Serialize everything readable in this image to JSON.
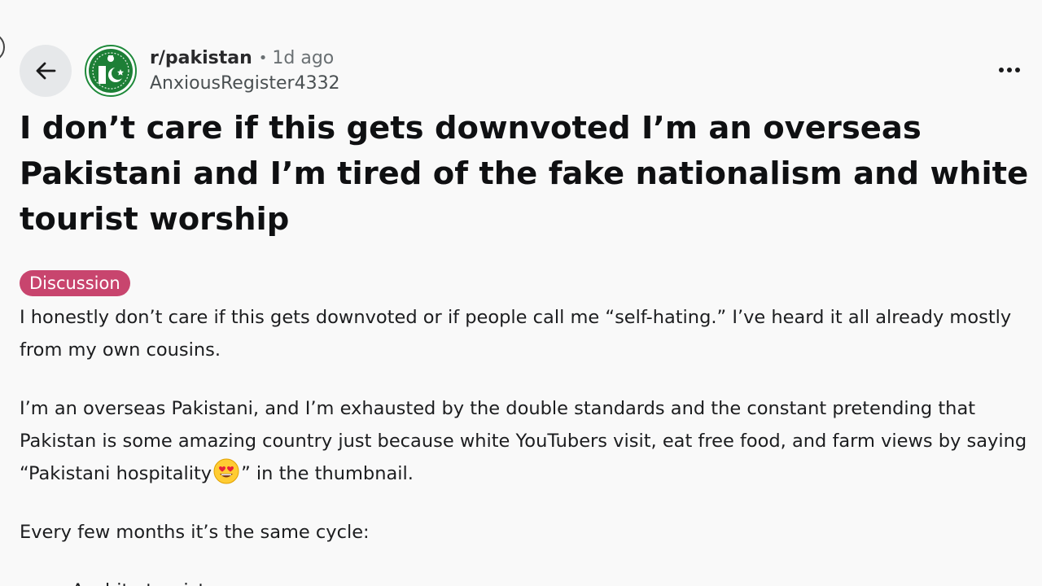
{
  "header": {
    "subreddit": "r/pakistan",
    "separator": "•",
    "time_ago": "1d ago",
    "username": "AnxiousRegister4332",
    "back_icon": "arrow-left-icon",
    "more_icon": "ellipsis-horizontal-icon",
    "subreddit_icon": "pakistan-flag-crest-icon"
  },
  "post": {
    "title": "I don’t care if this gets downvoted I’m an overseas Pakistani and I’m tired of the fake nationalism and white tourist worship",
    "flair": "Discussion",
    "flair_color": "#c8456e",
    "paragraphs": {
      "p1": "I honestly don’t care if this gets downvoted or if people call me “self-hating.” I’ve heard it all already mostly from my own cousins.",
      "p2_before_emoji": "I’m an overseas Pakistani, and I’m exhausted by the double standards and the constant pretending that Pakistan is some amazing country just because white YouTubers visit, eat free food, and farm views by saying “Pakistani hospitality",
      "p2_emoji": "heart-eyes-emoji",
      "p2_after_emoji": "” in the thumbnail.",
      "p3": "Every few months it’s the same cycle:"
    },
    "list_items": [
      "A white tourist comes"
    ]
  }
}
